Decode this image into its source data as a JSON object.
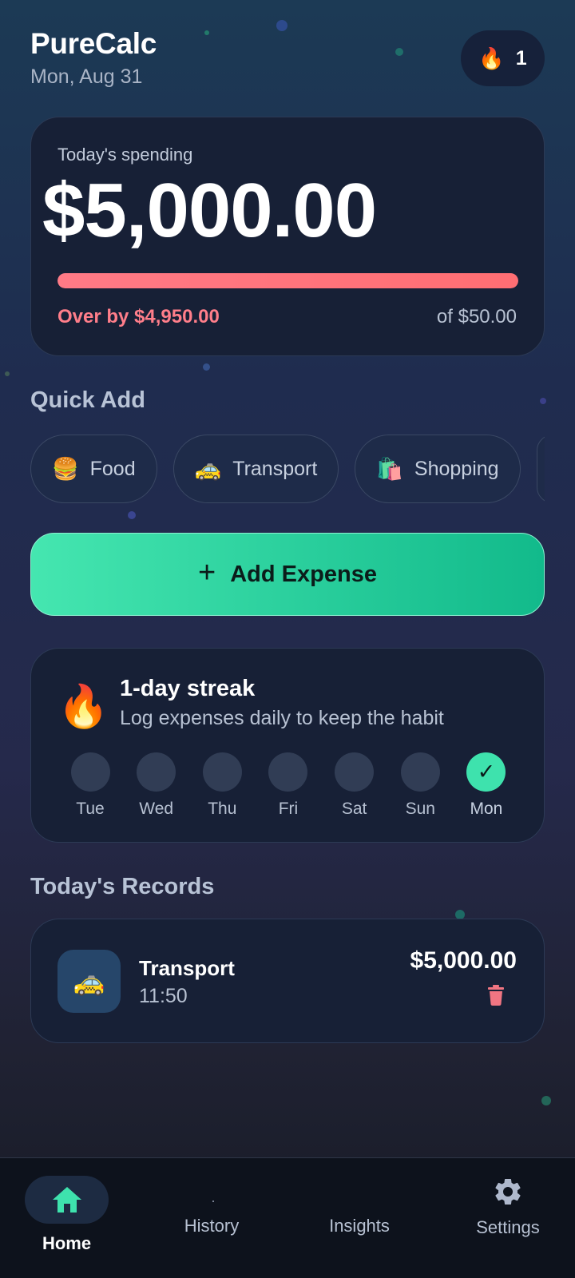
{
  "header": {
    "title": "PureCalc",
    "date": "Mon, Aug 31",
    "streak_count": "1",
    "streak_icon": "fire-icon"
  },
  "spending": {
    "label": "Today's spending",
    "amount": "$5,000.00",
    "progress_percent": 100,
    "over_text": "Over by $4,950.00",
    "budget_text": "of $50.00"
  },
  "quick_add": {
    "title": "Quick Add",
    "chips": [
      {
        "icon": "🍔",
        "label": "Food"
      },
      {
        "icon": "🚕",
        "label": "Transport"
      },
      {
        "icon": "🛍️",
        "label": "Shopping"
      }
    ]
  },
  "add_expense": {
    "label": "Add Expense",
    "icon": "+"
  },
  "streak": {
    "icon": "🔥",
    "title": "1-day streak",
    "subtitle": "Log expenses daily to keep the habit",
    "days": [
      {
        "label": "Tue",
        "done": false
      },
      {
        "label": "Wed",
        "done": false
      },
      {
        "label": "Thu",
        "done": false
      },
      {
        "label": "Fri",
        "done": false
      },
      {
        "label": "Sat",
        "done": false
      },
      {
        "label": "Sun",
        "done": false
      },
      {
        "label": "Mon",
        "done": true
      }
    ],
    "check_glyph": "✓"
  },
  "records": {
    "title": "Today's Records",
    "items": [
      {
        "icon": "🚕",
        "name": "Transport",
        "time": "11:50",
        "amount": "$5,000.00"
      }
    ]
  },
  "nav": {
    "home": "Home",
    "history": "History",
    "insights": "Insights",
    "settings": "Settings"
  },
  "colors": {
    "accent": "#3ee2ad",
    "danger": "#ff7e8a",
    "card_bg": "#172036"
  }
}
